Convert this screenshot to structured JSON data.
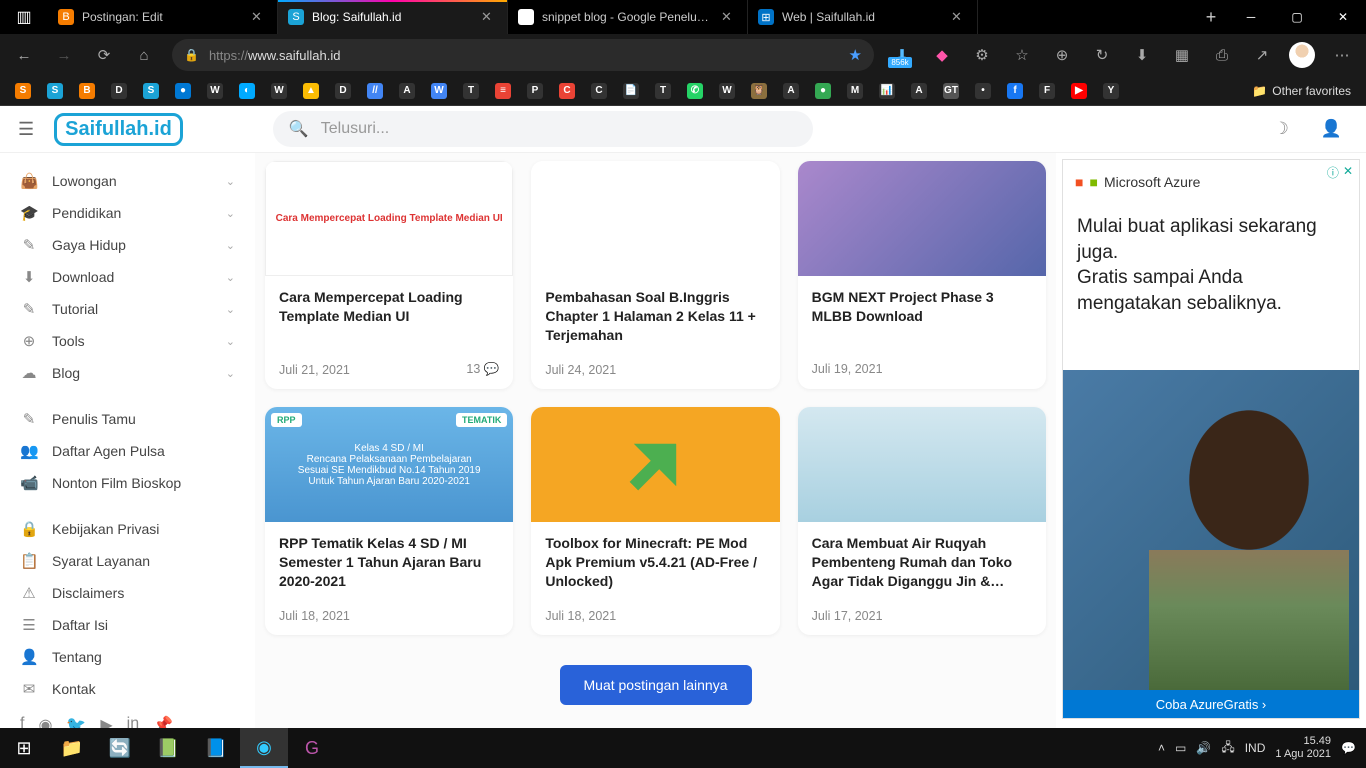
{
  "tabs": [
    {
      "label": "Postingan: Edit",
      "icon_bg": "#f57c00",
      "icon_txt": "B"
    },
    {
      "label": "Blog: Saifullah.id",
      "icon_bg": "#1ba3d6",
      "icon_txt": "S",
      "active": true
    },
    {
      "label": "snippet blog - Google Penelusur",
      "icon_bg": "#fff",
      "icon_txt": "G"
    },
    {
      "label": "Web | Saifullah.id",
      "icon_bg": "#0072c6",
      "icon_txt": "⊞"
    }
  ],
  "url": {
    "proto": "https://",
    "host": "www.saifullah.id"
  },
  "ext_badge": "856k",
  "bookmarks": [
    {
      "l": "S",
      "bg": "#f57c00"
    },
    {
      "l": "S",
      "bg": "#1ba3d6"
    },
    {
      "l": "B",
      "bg": "#f57c00"
    },
    {
      "l": "D",
      "bg": "#333"
    },
    {
      "l": "S",
      "bg": "#1ba3d6"
    },
    {
      "l": "●",
      "bg": "#0078d4"
    },
    {
      "l": "W",
      "bg": "#333"
    },
    {
      "l": "◐",
      "bg": "#0af"
    },
    {
      "l": "W",
      "bg": "#333"
    },
    {
      "l": "▲",
      "bg": "#fbbc04"
    },
    {
      "l": "D",
      "bg": "#333"
    },
    {
      "l": "//",
      "bg": "#4285f4"
    },
    {
      "l": "A",
      "bg": "#333"
    },
    {
      "l": "W",
      "bg": "#4285f4"
    },
    {
      "l": "T",
      "bg": "#333"
    },
    {
      "l": "≡",
      "bg": "#ea4335"
    },
    {
      "l": "P",
      "bg": "#333"
    },
    {
      "l": "C",
      "bg": "#ea4335"
    },
    {
      "l": "C",
      "bg": "#333"
    },
    {
      "l": "📄",
      "bg": "#333"
    },
    {
      "l": "T",
      "bg": "#333"
    },
    {
      "l": "✆",
      "bg": "#25d366"
    },
    {
      "l": "W",
      "bg": "#333"
    },
    {
      "l": "🦉",
      "bg": "#8b6f3e"
    },
    {
      "l": "A",
      "bg": "#333"
    },
    {
      "l": "●",
      "bg": "#34a853"
    },
    {
      "l": "M",
      "bg": "#333"
    },
    {
      "l": "📊",
      "bg": "#333"
    },
    {
      "l": "A",
      "bg": "#333"
    },
    {
      "l": "GT",
      "bg": "#555"
    },
    {
      "l": "",
      "bg": "#333"
    },
    {
      "l": "f",
      "bg": "#1877f2"
    },
    {
      "l": "F",
      "bg": "#333"
    },
    {
      "l": "▶",
      "bg": "#ff0000"
    },
    {
      "l": "Y",
      "bg": "#333"
    }
  ],
  "other_fav": "Other favorites",
  "search_placeholder": "Telusuri...",
  "nav": [
    {
      "icon": "👜",
      "label": "Lowongan",
      "exp": true
    },
    {
      "icon": "🎓",
      "label": "Pendidikan",
      "exp": true
    },
    {
      "icon": "✎",
      "label": "Gaya Hidup",
      "exp": true
    },
    {
      "icon": "⬇",
      "label": "Download",
      "exp": true
    },
    {
      "icon": "✎",
      "label": "Tutorial",
      "exp": true
    },
    {
      "icon": "⊕",
      "label": "Tools",
      "exp": true
    },
    {
      "icon": "☁",
      "label": "Blog",
      "exp": true
    }
  ],
  "nav2": [
    {
      "icon": "✎",
      "label": "Penulis Tamu"
    },
    {
      "icon": "👥",
      "label": "Daftar Agen Pulsa"
    },
    {
      "icon": "📹",
      "label": "Nonton Film Bioskop"
    }
  ],
  "nav3": [
    {
      "icon": "🔒",
      "label": "Kebijakan Privasi"
    },
    {
      "icon": "📋",
      "label": "Syarat Layanan"
    },
    {
      "icon": "⚠",
      "label": "Disclaimers"
    },
    {
      "icon": "☰",
      "label": "Daftar Isi"
    },
    {
      "icon": "👤",
      "label": "Tentang"
    },
    {
      "icon": "✉",
      "label": "Kontak"
    }
  ],
  "cards": [
    {
      "title": "Cara Mempercepat Loading Template Median UI",
      "date": "Juli 21, 2021",
      "comments": "13",
      "img": "ci1",
      "img_text": "Cara Mempercepat Loading Template Median UI"
    },
    {
      "title": "Pembahasan Soal B.Inggris Chapter 1 Halaman 2 Kelas 11 + Terjemahan",
      "date": "Juli 24, 2021",
      "img": "ci2"
    },
    {
      "title": "BGM NEXT Project Phase 3 MLBB Download",
      "date": "Juli 19, 2021",
      "img": "ci3"
    },
    {
      "title": "RPP Tematik Kelas 4 SD / MI Semester 1 Tahun Ajaran Baru 2020-2021",
      "date": "Juli 18, 2021",
      "img": "ci4",
      "img_text": "Kelas 4 SD / MI\nRencana Pelaksanaan Pembelajaran\nSesuai SE Mendikbud No.14 Tahun 2019\nUntuk Tahun Ajaran Baru 2020-2021",
      "badge_l": "RPP",
      "badge_r": "TEMATIK"
    },
    {
      "title": "Toolbox for Minecraft: PE Mod Apk Premium v5.4.21 (AD-Free / Unlocked)",
      "date": "Juli 18, 2021",
      "img": "ci5"
    },
    {
      "title": "Cara Membuat Air Ruqyah Pembenteng Rumah dan Toko Agar Tidak Diganggu Jin &…",
      "date": "Juli 17, 2021",
      "img": "ci6"
    }
  ],
  "loadmore": "Muat postingan lainnya",
  "ad": {
    "brand": "Microsoft Azure",
    "text": "Mulai buat aplikasi sekarang juga.\nGratis sampai Anda mengatakan sebaliknya.",
    "cta": "Coba AzureGratis ›"
  },
  "tray": {
    "lang": "IND",
    "time": "15.49",
    "date": "1 Agu 2021"
  },
  "logo_text": "Saifullah.id"
}
